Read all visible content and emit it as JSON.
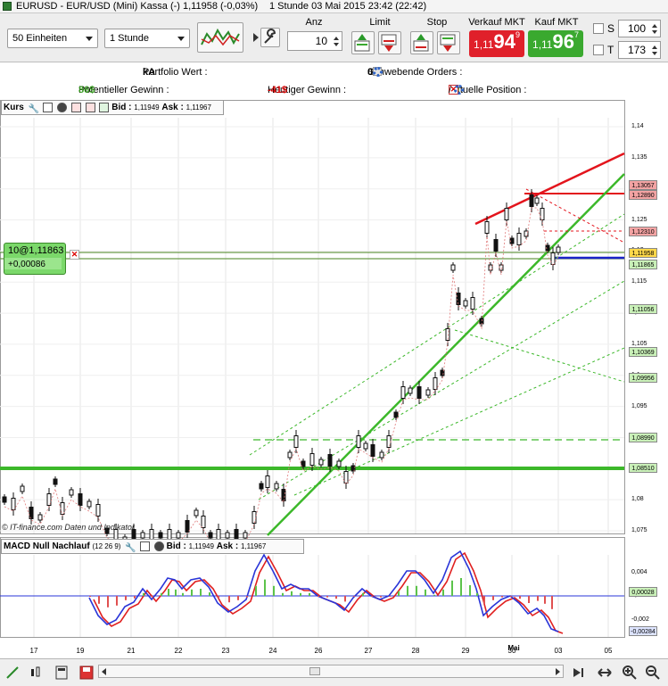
{
  "window": {
    "title": "EURUSD - EUR/USD (Mini) Kassa (-)",
    "price_change": "1,11958 (-0,03%)",
    "timeframe_date": "1 Stunde  03 Mai 2015 23:42 (22:42)"
  },
  "toolbar": {
    "units_select": "50 Einheiten",
    "period_select": "1 Stunde",
    "anz_label": "Anz",
    "anz_value": "10",
    "limit_label": "Limit",
    "stop_label": "Stop",
    "sell": {
      "label": "Verkauf MKT",
      "prefix": "1,11",
      "big": "94",
      "sup": "9"
    },
    "buy": {
      "label": "Kauf MKT",
      "prefix": "1,11",
      "big": "96",
      "sup": "7"
    },
    "s_label": "S",
    "s_value": "100",
    "t_label": "T",
    "t_value": "173"
  },
  "info": {
    "portfolio_label": "Portfolio Wert :",
    "portfolio_value": "kA",
    "pending_label": "Schwebende Orders :",
    "pending_value": "0",
    "potential_label": "Potentieller Gewinn :",
    "potential_value": "86$",
    "today_label": "Heutiger Gewinn :",
    "today_value": "-41$",
    "position_label": "Aktuelle Position :",
    "position_value": "10",
    "position_sep": "/",
    "position_zero": "0"
  },
  "price_pane": {
    "label": "Kurs",
    "bid_label": "Bid :",
    "bid_value": "1,11949",
    "ask_label": "Ask :",
    "ask_value": "1,11967",
    "position_box": "10@1,11863",
    "position_profit": "+0,00086",
    "watermark": "© IT-finance.com  Daten und Indikator",
    "y_ticks": [
      "1,14",
      "1,135",
      "1,13",
      "1,125",
      "1,12",
      "1,115",
      "1,11",
      "1,105",
      "1,1",
      "1,095",
      "1,09",
      "1,085",
      "1,08",
      "1,075"
    ],
    "price_labels": [
      "1,13057",
      "1,12890",
      "1,12310",
      "1,11958",
      "1,11865",
      "1,11056",
      "1,10369",
      "1,09956",
      "1,08990",
      "1,08510"
    ]
  },
  "macd_pane": {
    "label": "MACD Null Nachlauf",
    "params": "(12 26 9)",
    "bid_label": "Bid :",
    "bid_value": "1,11949",
    "ask_label": "Ask :",
    "ask_value": "1,11967",
    "y_ticks": [
      "0,004",
      "0,002",
      "-0,002"
    ],
    "value_labels": [
      "0,00028",
      "-0,00284"
    ]
  },
  "x_axis": [
    "17",
    "19",
    "21",
    "22",
    "23",
    "24",
    "26",
    "27",
    "28",
    "29",
    "30",
    "Mai",
    "03",
    "05"
  ],
  "colors": {
    "sell_button": "#e0202a",
    "buy_button": "#3aa92f",
    "trend_green": "#3cb82a",
    "resistance_red": "#e3141c",
    "macd_blue": "#2a35d8",
    "signal_red": "#e02020",
    "position_blue": "#1a22c8"
  }
}
